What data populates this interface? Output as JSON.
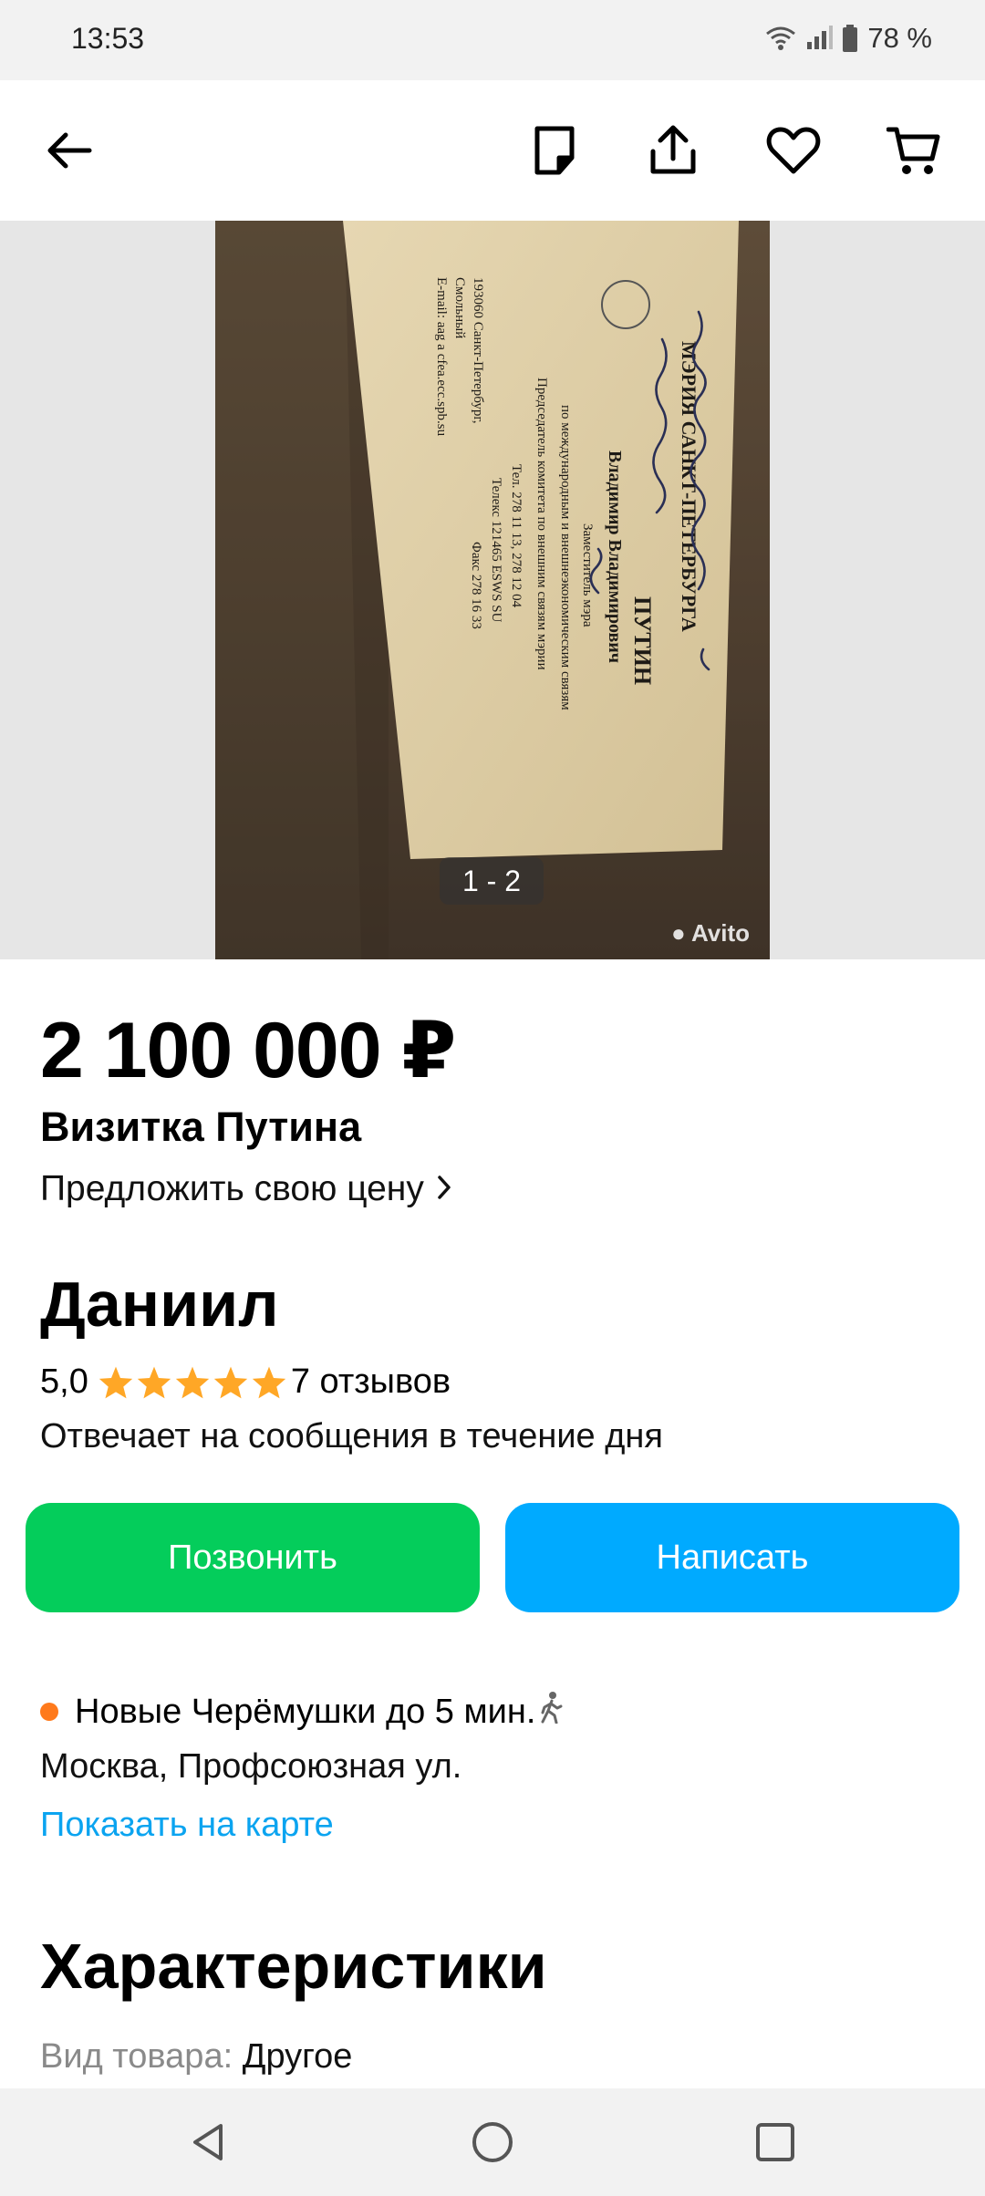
{
  "status_bar": {
    "time": "13:53",
    "battery": "78 %",
    "icons": [
      "wifi-icon",
      "signal-icon",
      "battery-icon"
    ]
  },
  "toolbar": {
    "icons": [
      "back-arrow-icon",
      "note-icon",
      "share-icon",
      "heart-icon",
      "cart-icon"
    ]
  },
  "gallery": {
    "counter": "1 - 2",
    "watermark": "Avito",
    "card_text": {
      "header": "МЭРИЯ САНКТ-ПЕТЕРБУРГА",
      "name": "ПУТИН",
      "full_name": "Владимир Владимирович",
      "position_1": "Заместитель мэра",
      "position_2": "по международным и внешнеэкономическим связям",
      "position_3": "Председатель комитета по внешним связям мэрии",
      "address_1": "193060 Санкт-Петербург,",
      "address_2": "Смольный",
      "email": "E-mail: aag a cfea.ecc.spb.su",
      "phone": "Тел. 278 11 13, 278 12 04",
      "telex": "Телекс 121465 ESWS SU",
      "fax": "Факс 278 16 33"
    }
  },
  "listing": {
    "price": "2 100 000 ₽",
    "title": "Визитка Путина",
    "offer_label": "Предложить свою цену"
  },
  "seller": {
    "name": "Даниил",
    "rating": "5,0",
    "stars": 5,
    "reviews": "7 отзывов",
    "response_time": "Отвечает на сообщения в течение дня"
  },
  "actions": {
    "call_label": "Позвонить",
    "write_label": "Написать"
  },
  "location": {
    "metro": "Новые Черёмушки до 5 мин.",
    "address": "Москва, Профсоюзная ул.",
    "map_link": "Показать на карте"
  },
  "characteristics": {
    "title": "Характеристики",
    "items": [
      {
        "key": "Вид товара:",
        "value": "Другое"
      }
    ]
  },
  "nav_bar": {
    "icons": [
      "nav-back-icon",
      "nav-home-icon",
      "nav-recents-icon"
    ]
  },
  "colors": {
    "call_button": "#04cd5b",
    "write_button": "#00aaff",
    "link": "#0ba4f0",
    "star": "#ffa726",
    "metro_dot": "#ff7a1c"
  }
}
